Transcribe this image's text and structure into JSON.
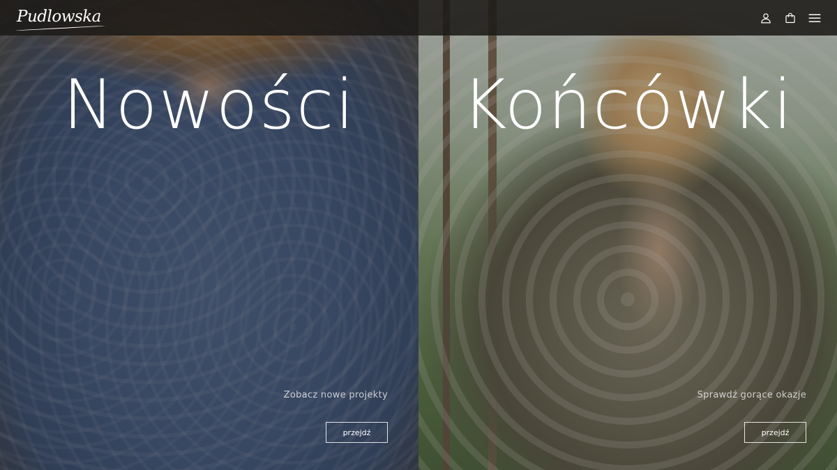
{
  "header": {
    "logo_text": "Pudlowska",
    "icons": [
      "user-icon",
      "shopping-bag-icon",
      "hamburger-menu-icon"
    ]
  },
  "panels": [
    {
      "title": "Nowości",
      "subtitle": "Zobacz nowe projekty",
      "button_label": "przejdź"
    },
    {
      "title": "Końcówki",
      "subtitle": "Sprawdź gorące okazje",
      "button_label": "przejdź"
    }
  ],
  "colors": {
    "header_bg": "#1c1a18",
    "text": "#ffffff",
    "button_border": "#ffffff"
  }
}
